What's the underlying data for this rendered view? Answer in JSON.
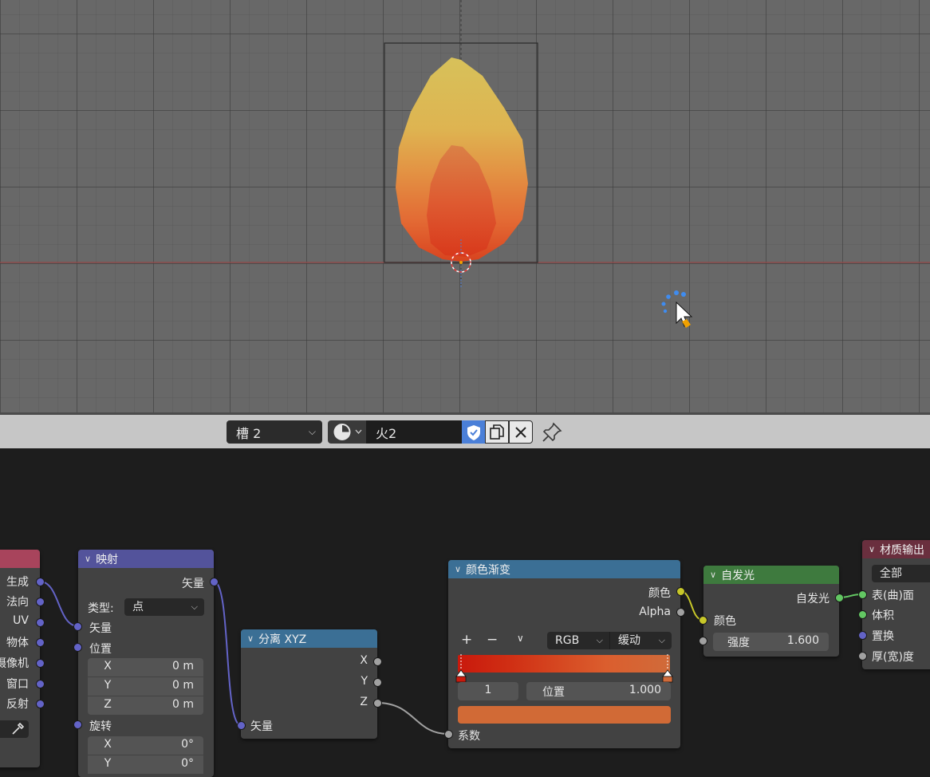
{
  "header": {
    "slot": "槽 2",
    "material_name": "火2"
  },
  "nodes": {
    "left_partial": {
      "outputs": [
        "生成",
        "法向",
        "UV",
        "物体",
        "摄像机",
        "窗口",
        "反射"
      ]
    },
    "mapping": {
      "title": "映射",
      "output_vector": "矢量",
      "type_label": "类型:",
      "type_value": "点",
      "input_vector": "矢量",
      "input_location": "位置",
      "location": [
        {
          "axis": "X",
          "value": "0 m"
        },
        {
          "axis": "Y",
          "value": "0 m"
        },
        {
          "axis": "Z",
          "value": "0 m"
        }
      ],
      "rotation_label": "旋转",
      "rotation": [
        {
          "axis": "X",
          "value": "0°"
        },
        {
          "axis": "Y",
          "value": "0°"
        }
      ]
    },
    "separate_xyz": {
      "title": "分离 XYZ",
      "outputs": [
        "X",
        "Y",
        "Z"
      ],
      "input_vector": "矢量"
    },
    "color_ramp": {
      "title": "颜色渐变",
      "out_color": "颜色",
      "out_alpha": "Alpha",
      "add_icon": "+",
      "remove_icon": "−",
      "color_mode": "RGB",
      "interpolation": "缓动",
      "stop_index": "1",
      "position_label": "位置",
      "position_value": "1.000",
      "input_fac": "系数",
      "colors": {
        "stop_left": "#c9190c",
        "stop_right": "#d06b3a",
        "swatch": "#d16a36"
      }
    },
    "emission": {
      "title": "自发光",
      "output": "自发光",
      "input_color": "颜色",
      "strength_label": "强度",
      "strength_value": "1.600"
    },
    "material_output": {
      "title": "材质输出",
      "target": "全部",
      "inputs": [
        "表(曲)面",
        "体积",
        "置换",
        "厚(宽)度"
      ]
    }
  },
  "colors": {
    "header_mapping": "#53539b",
    "header_separate": "#3b6f95",
    "header_colorramp": "#3b6f95",
    "header_emission": "#3e7a3e",
    "header_output": "#6a2f3e",
    "header_left": "#a8445c"
  },
  "icons": {
    "shading": "sphere-shading-icon",
    "fake_user": "shield-check-icon",
    "duplicate": "copy-icon",
    "unlink": "close-icon",
    "pin": "pin-icon",
    "eyedropper": "eyedropper-icon"
  }
}
